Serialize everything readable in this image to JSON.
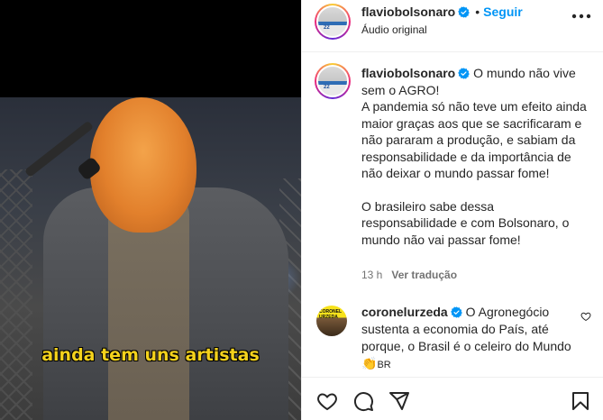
{
  "video": {
    "subtitle": "ainda tem uns artistas"
  },
  "header": {
    "username": "flaviobolsonaro",
    "separator": "•",
    "follow_label": "Seguir",
    "audio_label": "Áudio original"
  },
  "caption": {
    "username": "flaviobolsonaro",
    "first_line": "O mundo não vive sem o AGRO!",
    "paragraph1": "A pandemia só não teve um efeito ainda maior graças aos que se sacrificaram e não pararam a produção, e sabiam da responsabilidade e da importância de não deixar o mundo passar fome!",
    "paragraph2": "O brasileiro sabe dessa responsabilidade e com Bolsonaro, o mundo não vai passar fome!",
    "time": "13 h",
    "translate_label": "Ver tradução"
  },
  "comment": {
    "username": "coronelurzeda",
    "text": "O Agronegócio sustenta a economia do País, até porque, o Brasil é o celeiro do Mundo",
    "emoji": "👏",
    "suffix": "BR"
  },
  "colors": {
    "link_blue": "#0095f6",
    "verified_blue": "#0095f6",
    "subtitle_yellow": "#f4d21c",
    "muted": "#737373"
  },
  "icons": [
    "verified-icon",
    "more-options-icon",
    "heart-icon",
    "comment-icon",
    "share-icon",
    "bookmark-icon",
    "clap-emoji"
  ]
}
